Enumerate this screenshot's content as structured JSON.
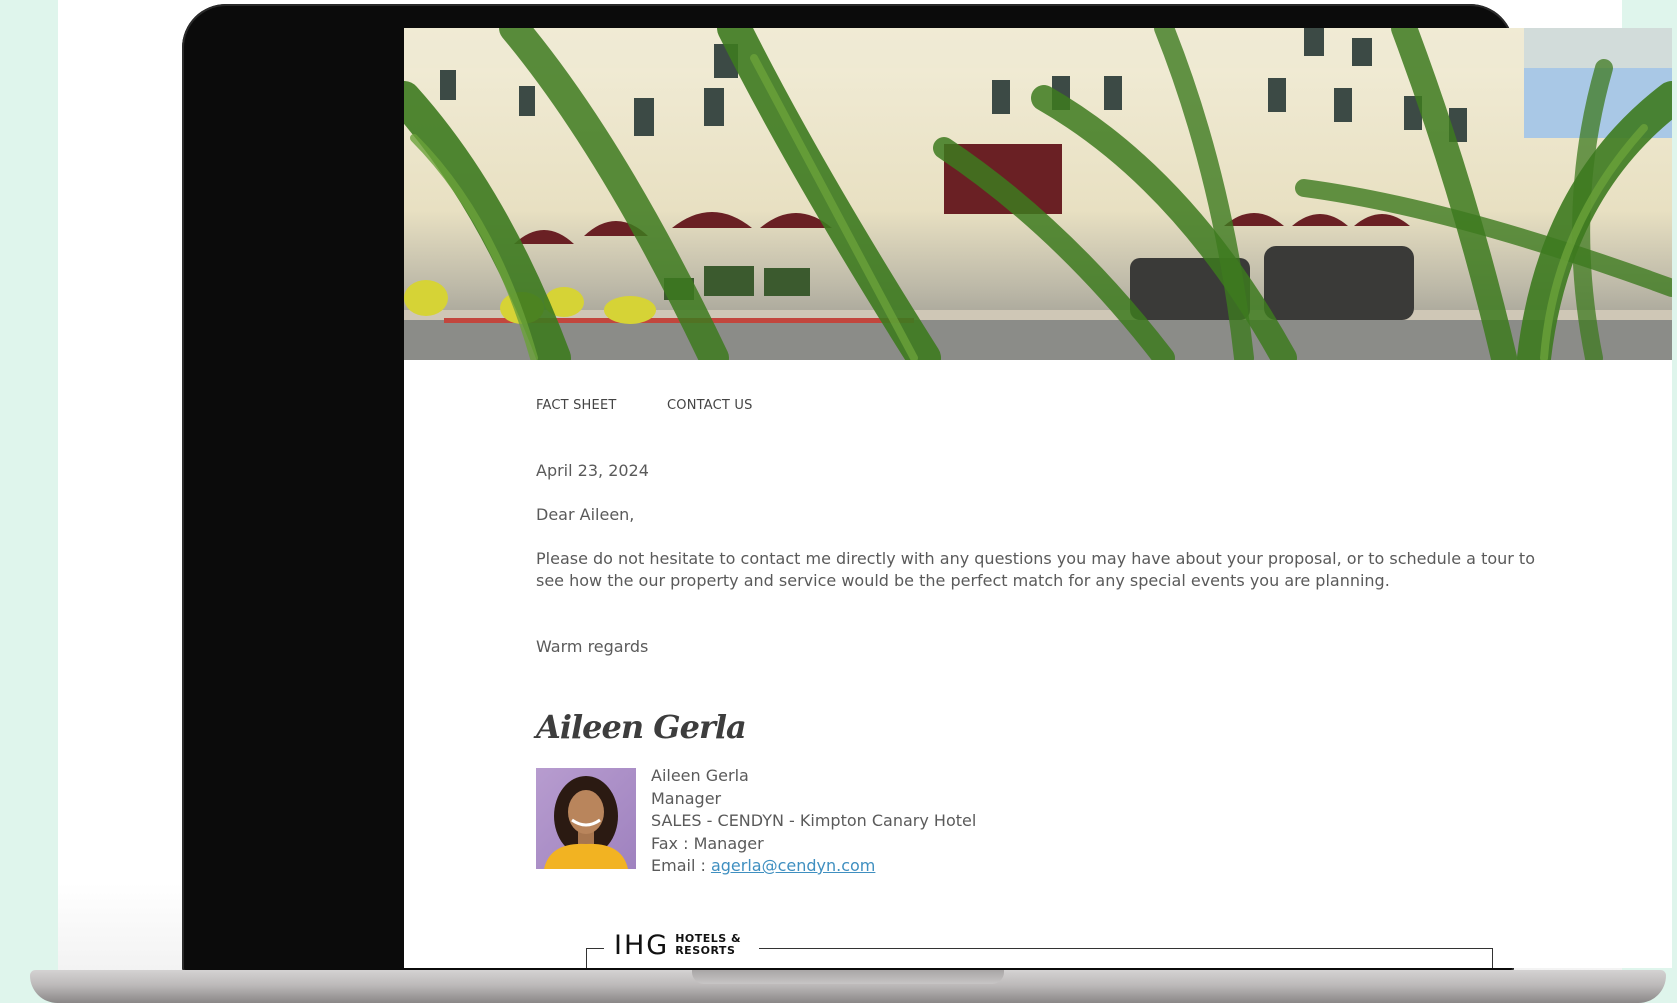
{
  "nav": {
    "fact_sheet": "FACT SHEET",
    "contact_us": "CONTACT US"
  },
  "letter": {
    "date": "April 23, 2024",
    "greeting": "Dear Aileen,",
    "body": "Please do not hesitate to contact me directly with any questions you may have about your proposal, or to schedule a tour to see how the our property and service would be the perfect match for any special events you are planning.",
    "closing": "Warm regards"
  },
  "signature": {
    "script_name": "Aileen Gerla",
    "name": "Aileen Gerla",
    "title": "Manager",
    "department": "SALES - CENDYN - Kimpton Canary Hotel",
    "fax": "Fax : Manager",
    "email_label": "Email : ",
    "email": "agerla@cendyn.com"
  },
  "footer": {
    "logo_mark": "IHG",
    "logo_line1": "HOTELS &",
    "logo_line2": "RESORTS"
  },
  "colors": {
    "background": "#dff5ec",
    "link": "#3f8fc0",
    "text": "#5a5a5a"
  }
}
